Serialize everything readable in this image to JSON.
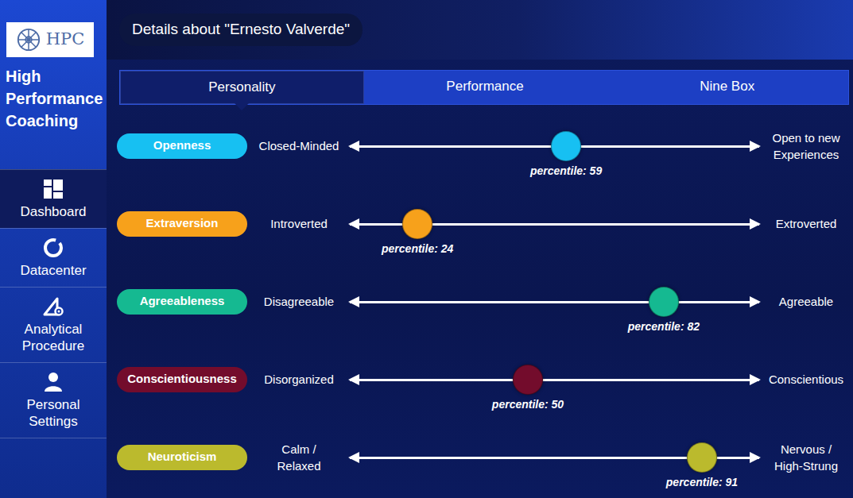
{
  "logo": {
    "text": "HPC"
  },
  "sidebar": {
    "title": "High Performance Coaching",
    "items": [
      {
        "label": "Dashboard",
        "selected": true
      },
      {
        "label": "Datacenter",
        "selected": false
      },
      {
        "label": "Analytical Procedure",
        "selected": false
      },
      {
        "label": "Personal Settings",
        "selected": false
      }
    ]
  },
  "header": {
    "title": "Details about \"Ernesto Valverde\""
  },
  "tabs": [
    {
      "label": "Personality",
      "selected": true
    },
    {
      "label": "Performance",
      "selected": false
    },
    {
      "label": "Nine Box",
      "selected": false
    }
  ],
  "traits": [
    {
      "name": "Openness",
      "low": "Closed-Minded",
      "high": "Open to new\nExperiences",
      "percentile": "percentile: 59",
      "level": 0.59,
      "color": "#17c0f2"
    },
    {
      "name": "Extraversion",
      "low": "Introverted",
      "high": "Extroverted",
      "percentile": "percentile: 24",
      "level": 0.24,
      "color": "#f7a11b"
    },
    {
      "name": "Agreeableness",
      "low": "Disagreeable",
      "high": "Agreeable",
      "percentile": "percentile: 82",
      "level": 0.82,
      "color": "#15b991"
    },
    {
      "name": "Conscientiousness",
      "low": "Disorganized",
      "high": "Conscientious",
      "percentile": "percentile: 50",
      "level": 0.5,
      "color": "#730c2c"
    },
    {
      "name": "Neuroticism",
      "low": "Calm /\nRelaxed",
      "high": "Nervous /\nHigh-Strung",
      "percentile": "percentile: 91",
      "level": 0.91,
      "color": "#bbba2d"
    }
  ]
}
